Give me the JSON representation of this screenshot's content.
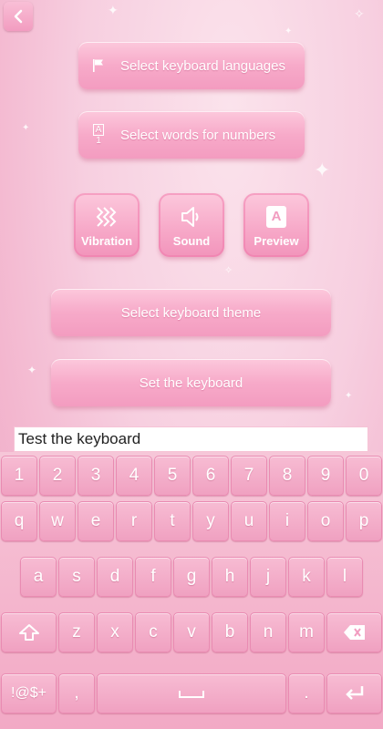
{
  "header": {
    "back_icon": "back-arrow-icon"
  },
  "menu": {
    "languages_label": "Select keyboard languages",
    "languages_icon": "flag-icon",
    "numbers_label": "Select words for numbers",
    "numbers_icon": "a1-icon",
    "numbers_icon_top": "A",
    "numbers_icon_bottom": "1",
    "vibration_label": "Vibration",
    "vibration_icon": "vibration-icon",
    "sound_label": "Sound",
    "sound_icon": "speaker-icon",
    "preview_label": "Preview",
    "preview_icon": "preview-icon",
    "preview_icon_letter": "A",
    "theme_label": "Select keyboard theme",
    "set_label": "Set the keyboard"
  },
  "test_input": {
    "value": "Test the keyboard"
  },
  "keyboard": {
    "row_numbers": [
      "1",
      "2",
      "3",
      "4",
      "5",
      "6",
      "7",
      "8",
      "9",
      "0"
    ],
    "row_top": [
      "q",
      "w",
      "e",
      "r",
      "t",
      "y",
      "u",
      "i",
      "o",
      "p"
    ],
    "row_middle": [
      "a",
      "s",
      "d",
      "f",
      "g",
      "h",
      "j",
      "k",
      "l"
    ],
    "row_bottom": [
      "z",
      "x",
      "c",
      "v",
      "b",
      "n",
      "m"
    ],
    "symbols_label": "!@$+",
    "comma_label": ",",
    "period_label": ".",
    "shift_icon": "shift-icon",
    "backspace_icon": "backspace-icon",
    "space_icon": "space-icon",
    "enter_icon": "enter-icon"
  },
  "colors": {
    "accent": "#f29cc0",
    "background": "#f7cfe0",
    "text": "#ffffff"
  }
}
